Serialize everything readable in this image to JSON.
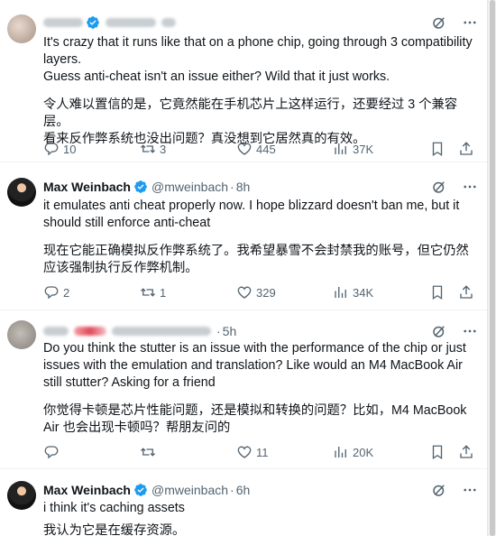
{
  "tweets": [
    {
      "name": "",
      "handle": "",
      "time": "",
      "body": [
        "It's crazy that it runs like that on a phone chip, going through 3 compatibility layers.",
        "Guess anti-cheat isn't an issue either? Wild that it just works."
      ],
      "translation": [
        "令人难以置信的是，它竟然能在手机芯片上这样运行，还要经过 3 个兼容层。",
        "看来反作弊系统也没出问题？真没想到它居然真的有效。"
      ],
      "replies": "10",
      "reposts": "3",
      "likes": "445",
      "views": "37K"
    },
    {
      "name": "Max Weinbach",
      "handle": "@mweinbach",
      "time": "8h",
      "body": [
        "it emulates anti cheat properly now. I hope blizzard doesn't ban me, but it should still enforce anti-cheat"
      ],
      "translation": [
        "现在它能正确模拟反作弊系统了。我希望暴雪不会封禁我的账号，但它仍然应该强制执行反作弊机制。"
      ],
      "replies": "2",
      "reposts": "1",
      "likes": "329",
      "views": "34K"
    },
    {
      "name": "",
      "handle": "",
      "time": "5h",
      "body": [
        "Do you think the stutter is an issue with the performance of the chip or just issues with the emulation and translation? Like would an M4 MacBook Air still stutter? Asking for a friend"
      ],
      "translation": [
        "你觉得卡顿是芯片性能问题，还是模拟和转换的问题？比如，M4 MacBook Air 也会出现卡顿吗？帮朋友问的"
      ],
      "replies": "",
      "reposts": "",
      "likes": "11",
      "views": "20K"
    },
    {
      "name": "Max Weinbach",
      "handle": "@mweinbach",
      "time": "6h",
      "body": [
        "i think it's caching assets"
      ],
      "translation": [
        "我认为它是在缓存资源。"
      ]
    }
  ],
  "sep": "·",
  "colors": {
    "verified": "#1d9bf0",
    "muted": "#536471",
    "text": "#0f1419"
  }
}
